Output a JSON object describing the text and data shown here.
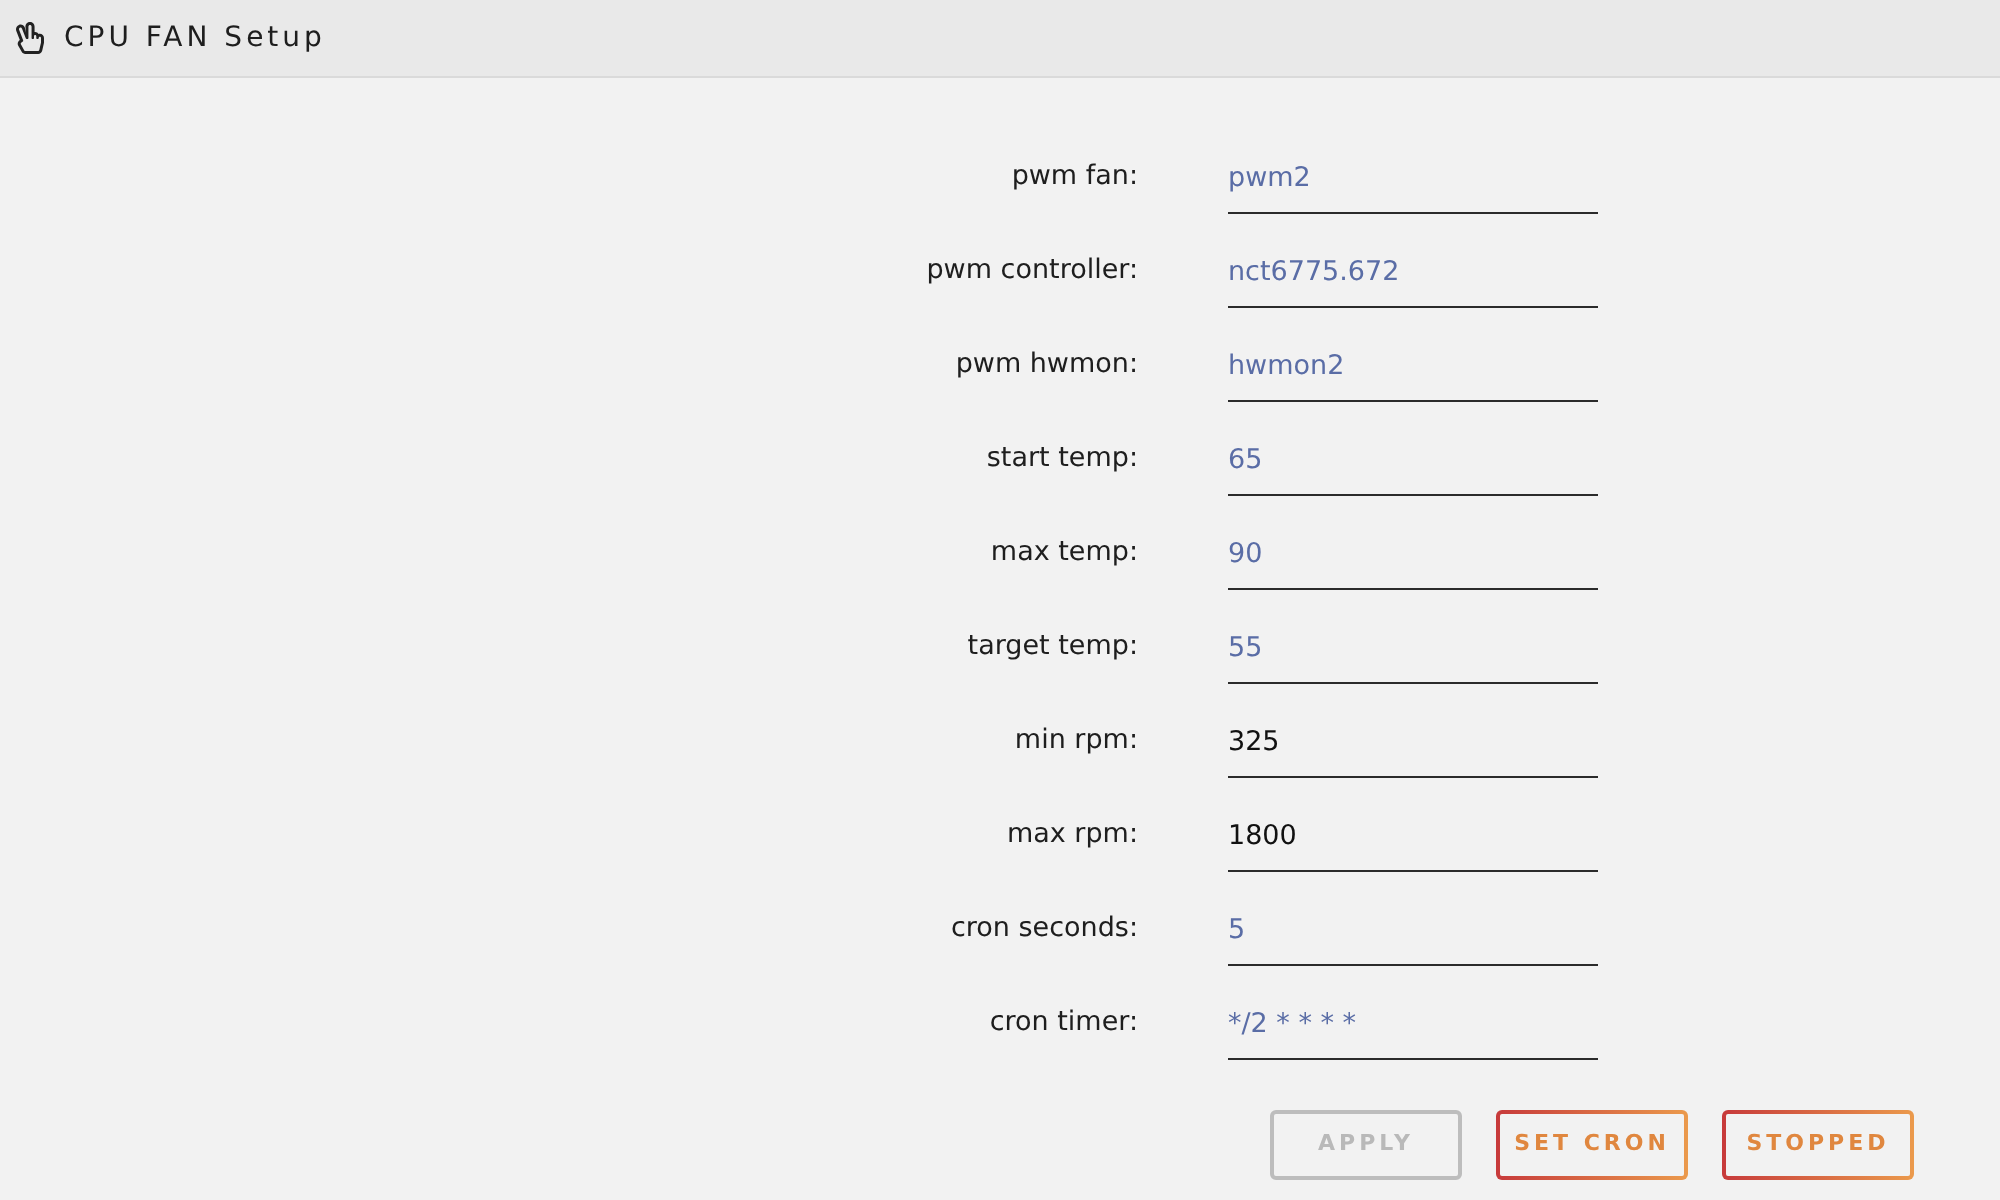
{
  "window": {
    "title": "CPU FAN Setup"
  },
  "fields": [
    {
      "label": "pwm fan:",
      "placeholder": "pwm2"
    },
    {
      "label": "pwm controller:",
      "placeholder": "nct6775.672"
    },
    {
      "label": "pwm hwmon:",
      "placeholder": "hwmon2"
    },
    {
      "label": "start temp:",
      "placeholder": "65"
    },
    {
      "label": "max temp:",
      "placeholder": "90"
    },
    {
      "label": "target temp:",
      "placeholder": "55"
    },
    {
      "label": "min rpm:",
      "value": "325"
    },
    {
      "label": "max rpm:",
      "value": "1800"
    },
    {
      "label": "cron seconds:",
      "placeholder": "5"
    },
    {
      "label": "cron timer:",
      "placeholder": "*/2 * * * *"
    }
  ],
  "buttons": [
    {
      "label": "APPLY",
      "disabled": true
    },
    {
      "label": "SET CRON",
      "disabled": false
    },
    {
      "label": "STOPPED",
      "disabled": false
    }
  ]
}
